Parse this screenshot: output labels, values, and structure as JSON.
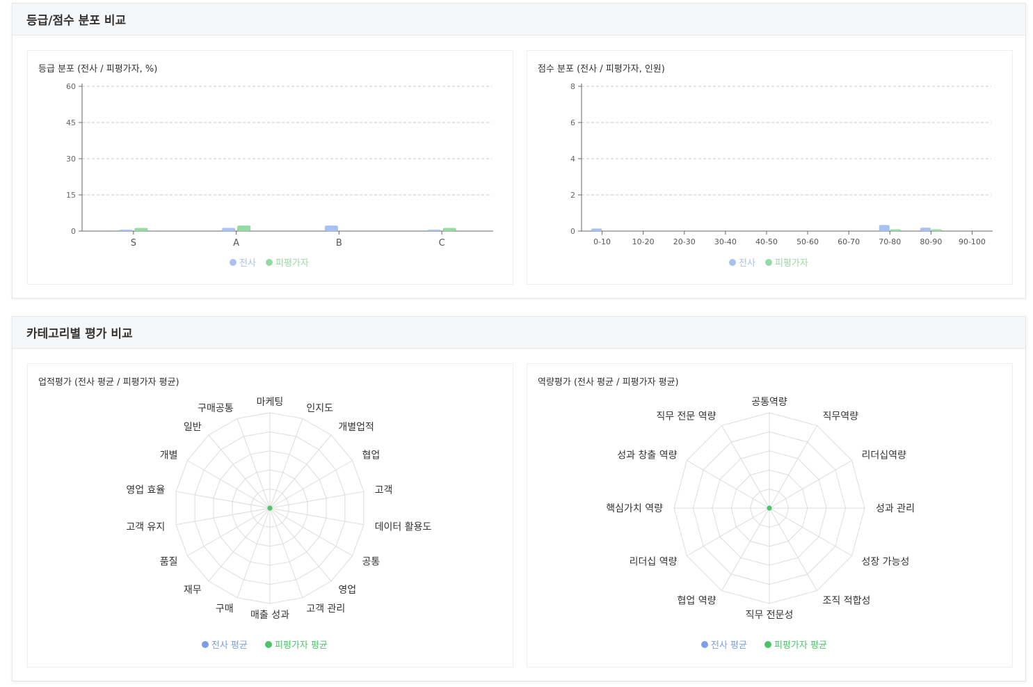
{
  "sections": [
    {
      "title": "등급/점수 분포 비교"
    },
    {
      "title": "카테고리별 평가 비교"
    }
  ],
  "colors": {
    "company": "#a9c1f2",
    "evaluatee": "#93dba3",
    "company_strong": "#7c9ee8",
    "evaluatee_strong": "#4ec46a"
  },
  "chart_data": [
    {
      "type": "bar",
      "title": "등급 분포 (전사 / 피평가자, %)",
      "categories": [
        "S",
        "A",
        "B",
        "C"
      ],
      "yticks": [
        "0",
        "15",
        "30",
        "45",
        "60"
      ],
      "ylim": [
        0,
        60
      ],
      "grid": true,
      "legend": "bottom",
      "series": [
        {
          "name": "전사",
          "values": [
            0.3,
            1.0,
            2.0,
            0.3
          ]
        },
        {
          "name": "피평가자",
          "values": [
            1.0,
            2.0,
            0,
            1.0
          ]
        }
      ]
    },
    {
      "type": "bar",
      "title": "점수 분포 (전사 / 피평가자, 인원)",
      "categories": [
        "0-10",
        "10-20",
        "20-30",
        "30-40",
        "40-50",
        "50-60",
        "60-70",
        "70-80",
        "80-90",
        "90-100"
      ],
      "yticks": [
        "0",
        "2",
        "4",
        "6",
        "8"
      ],
      "ylim": [
        0,
        8
      ],
      "grid": true,
      "legend": "bottom",
      "series": [
        {
          "name": "전사",
          "values": [
            0.1,
            0,
            0,
            0,
            0,
            0,
            0,
            0.3,
            0.15,
            0
          ]
        },
        {
          "name": "피평가자",
          "values": [
            0,
            0,
            0,
            0,
            0,
            0,
            0,
            0.06,
            0.06,
            0
          ]
        }
      ]
    },
    {
      "type": "radar",
      "title": "업적평가 (전사 평균 / 피평가자 평균)",
      "categories": [
        "마케팅",
        "인지도",
        "개별업적",
        "협업",
        "고객",
        "데이터 활용도",
        "공통",
        "영업",
        "고객 관리",
        "매출 성과",
        "구매",
        "재무",
        "품질",
        "고객 유지",
        "영업 효율",
        "개별",
        "일반",
        "구매공통"
      ],
      "legend": "bottom",
      "series": [
        {
          "name": "전사 평균",
          "values": [
            0,
            0,
            0,
            0,
            0,
            0,
            0,
            0,
            0,
            0,
            0,
            0,
            0,
            0,
            0,
            0,
            0,
            0
          ]
        },
        {
          "name": "피평가자 평균",
          "values": [
            0,
            0,
            0,
            0,
            0,
            0,
            0,
            0,
            0,
            0,
            0,
            0,
            0,
            0,
            0,
            0,
            0,
            0
          ]
        }
      ]
    },
    {
      "type": "radar",
      "title": "역량평가 (전사 평균 / 피평가자 평균)",
      "categories": [
        "공통역량",
        "직무역량",
        "리더십역량",
        "성과 관리",
        "성장 가능성",
        "조직 적합성",
        "직무 전문성",
        "협업 역량",
        "리더십 역량",
        "핵심가치 역량",
        "성과 창출 역량",
        "직무 전문 역량"
      ],
      "legend": "bottom",
      "series": [
        {
          "name": "전사 평균",
          "values": [
            0,
            0,
            0,
            0,
            0,
            0,
            0,
            0,
            0,
            0,
            0,
            0
          ]
        },
        {
          "name": "피평가자 평균",
          "values": [
            0,
            0,
            0,
            0,
            0,
            0,
            0,
            0,
            0,
            0,
            0,
            0
          ]
        }
      ]
    }
  ]
}
